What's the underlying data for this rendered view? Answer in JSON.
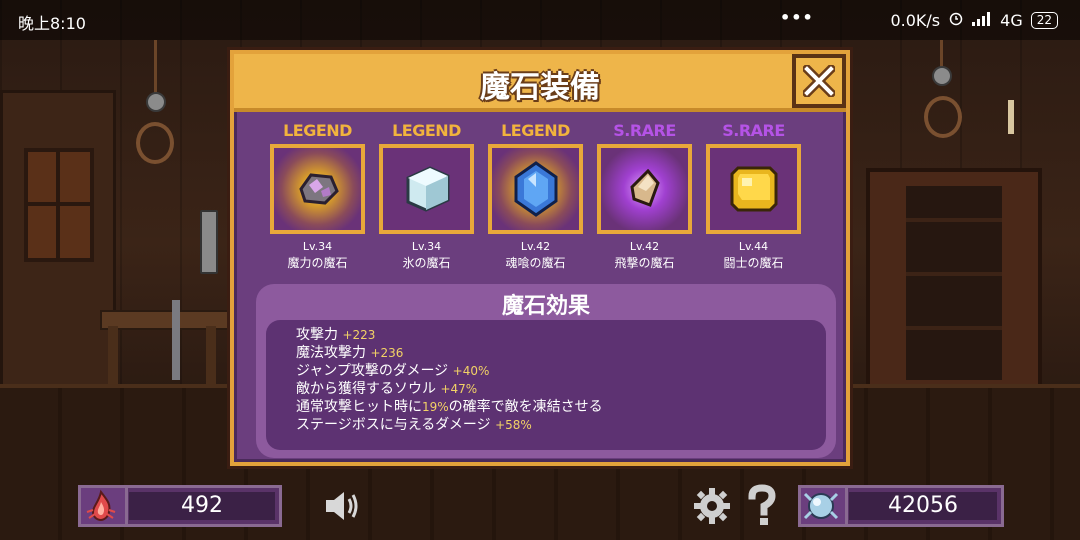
{
  "status_bar": {
    "time": "晚上8:10",
    "dots": "•••",
    "speed": "0.0K/s",
    "network": "4G",
    "battery": "22"
  },
  "modal": {
    "title": "魔石装備",
    "close_icon": "close-x-icon",
    "gems": [
      {
        "rarity": "LEGEND",
        "level": "Lv.34",
        "name": "魔力の魔石",
        "icon": "grey-crystal-gem-icon",
        "rarity_color": "#f2b33d"
      },
      {
        "rarity": "LEGEND",
        "level": "Lv.34",
        "name": "氷の魔石",
        "icon": "ice-cube-gem-icon",
        "rarity_color": "#f2b33d"
      },
      {
        "rarity": "LEGEND",
        "level": "Lv.42",
        "name": "魂喰の魔石",
        "icon": "blue-crystal-gem-icon",
        "rarity_color": "#f2b33d"
      },
      {
        "rarity": "S.RARE",
        "level": "Lv.42",
        "name": "飛撃の魔石",
        "icon": "tan-shard-gem-icon",
        "rarity_color": "#b553e6"
      },
      {
        "rarity": "S.RARE",
        "level": "Lv.44",
        "name": "闘士の魔石",
        "icon": "gold-block-gem-icon",
        "rarity_color": "#b553e6"
      }
    ],
    "effects_title": "魔石効果",
    "effects": [
      {
        "text": "攻撃力",
        "value": "+223",
        "suffix": ""
      },
      {
        "text": "魔法攻撃力",
        "value": "+236",
        "suffix": ""
      },
      {
        "text": "ジャンプ攻撃のダメージ",
        "value": "+40%",
        "suffix": ""
      },
      {
        "text": "敵から獲得するソウル",
        "value": "+47%",
        "suffix": ""
      },
      {
        "text": "通常攻撃ヒット時に",
        "value": "19%",
        "suffix": "の確率で敵を凍結させる"
      },
      {
        "text": "ステージボスに与えるダメージ",
        "value": "+58%",
        "suffix": ""
      }
    ]
  },
  "hud": {
    "souls_value": "492",
    "stones_value": "42056",
    "sound_icon": "speaker-icon",
    "settings_icon": "gear-icon",
    "help_icon": "question-mark-icon",
    "souls_icon": "red-flame-soul-icon",
    "stones_icon": "crystal-orb-icon"
  },
  "colors": {
    "modal_bg": "#6b3e7e",
    "header": "#eeb54a",
    "border": "#e3a23b",
    "legend": "#f2b33d",
    "srare": "#b553e6",
    "effect_value": "#f2d266"
  }
}
